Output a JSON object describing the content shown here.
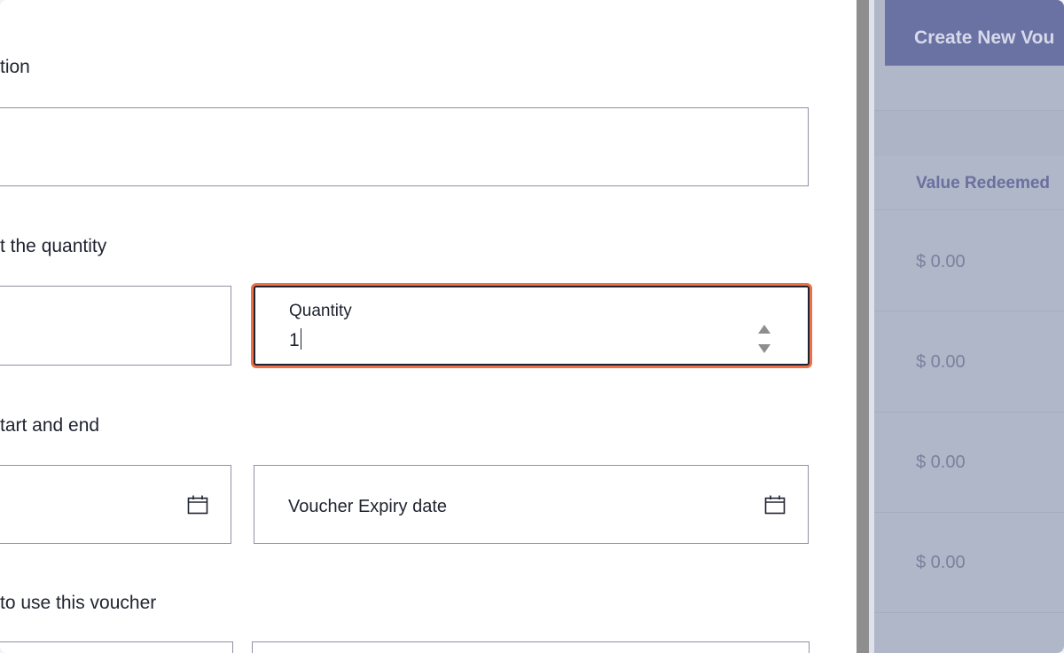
{
  "form": {
    "sections": {
      "description_label": "tion",
      "quantity_label": "t the quantity",
      "dates_label": "tart and end",
      "usage_label": "to use this voucher"
    },
    "quantity_field": {
      "label": "Quantity",
      "value": "1"
    },
    "expiry_field": {
      "label": "Voucher Expiry date"
    }
  },
  "right_panel": {
    "create_button": "Create New Vou",
    "column_header": "Value Redeemed",
    "rows": [
      "$ 0.00",
      "$ 0.00",
      "$ 0.00",
      "$ 0.00"
    ]
  },
  "icons": {
    "calendar": "calendar-icon",
    "stepper": "stepper-arrows-icon"
  },
  "colors": {
    "focus_ring": "#ef6f46",
    "button_bg": "#6a71a3",
    "overlay_bg": "#b0b7c8"
  }
}
